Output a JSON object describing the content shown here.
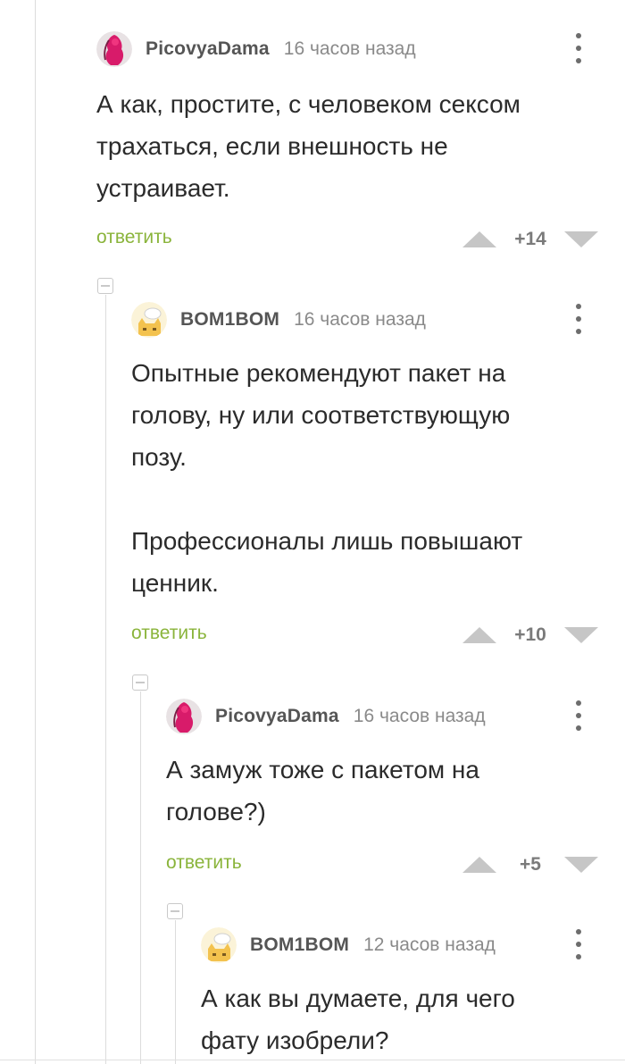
{
  "comments": [
    {
      "author": "PicovyaDama",
      "time": "16 часов назад",
      "avatar": "avatar-pink-figure",
      "text": "А как, простите, с человеком сексом\nтрахаться, если внешность не\nустраивает.",
      "reply_label": "ответить",
      "score": "+14"
    },
    {
      "author": "BOM1BOM",
      "time": "16 часов назад",
      "avatar": "avatar-cat",
      "text": "Опытные рекомендуют пакет на\nголову, ну или соответствующую\nпозу.\n\nПрофессионалы лишь повышают\nценник.",
      "reply_label": "ответить",
      "score": "+10"
    },
    {
      "author": "PicovyaDama",
      "time": "16 часов назад",
      "avatar": "avatar-pink-figure",
      "text": "А замуж тоже с пакетом на\nголове?)",
      "reply_label": "ответить",
      "score": "+5"
    },
    {
      "author": "BOM1BOM",
      "time": "12 часов назад",
      "avatar": "avatar-cat",
      "text": "А как вы думаете, для чего\nфату изобрели?"
    }
  ],
  "colors": {
    "reply_link": "#8ab43b",
    "vote_arrow": "#c6c6c6",
    "thread_line": "#dcdcdc"
  }
}
